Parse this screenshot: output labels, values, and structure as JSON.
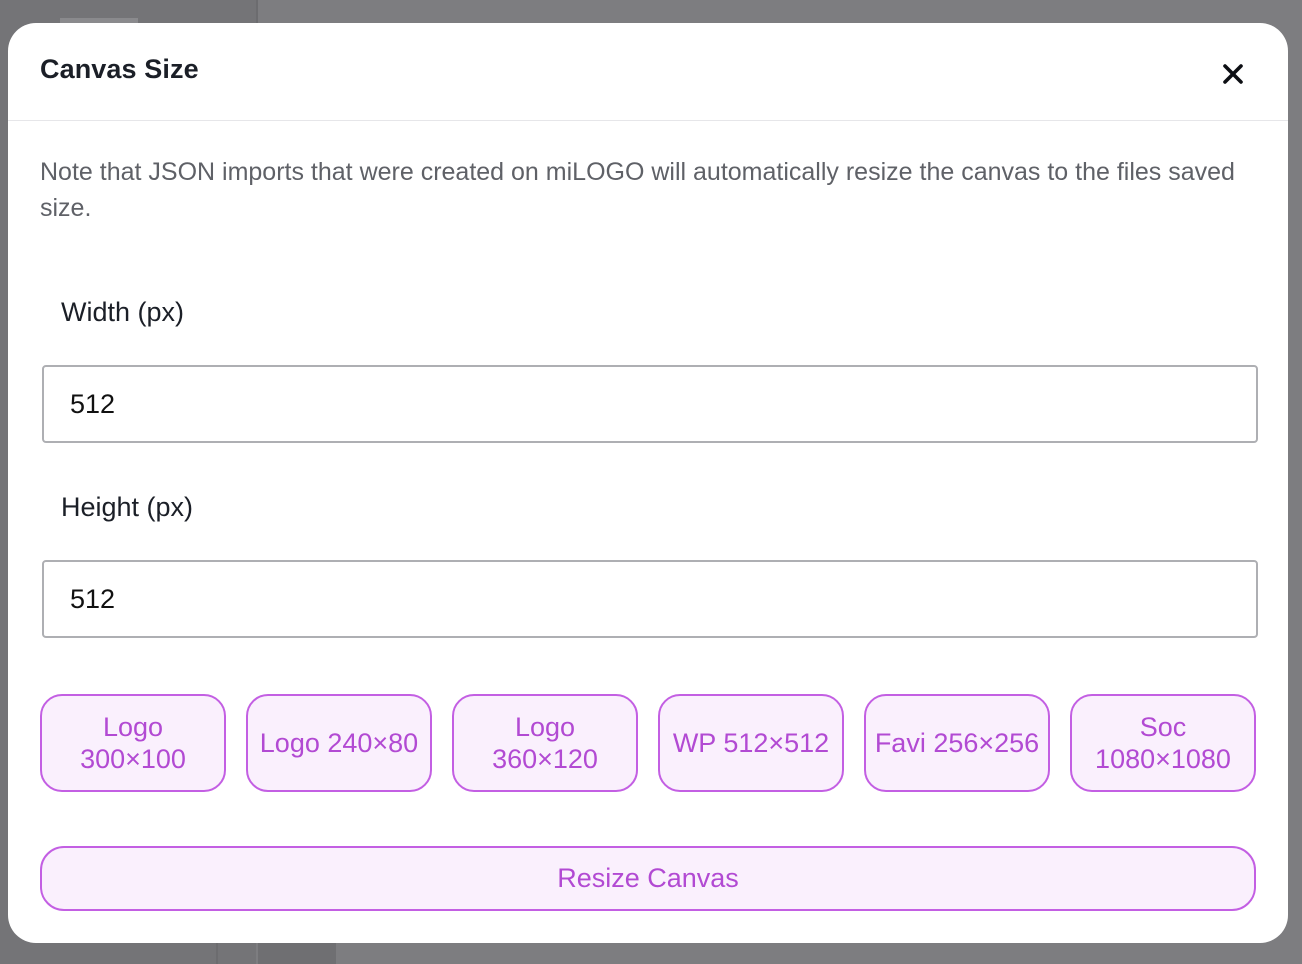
{
  "modal": {
    "title": "Canvas Size",
    "close_icon": "close-icon",
    "note": "Note that JSON imports that were created on miLOGO will automatically resize the canvas to the files saved size."
  },
  "width_field": {
    "label": "Width (px)",
    "value": "512"
  },
  "height_field": {
    "label": "Height (px)",
    "value": "512"
  },
  "presets": [
    {
      "label": "Logo 300×100"
    },
    {
      "label": "Logo 240×80"
    },
    {
      "label": "Logo 360×120"
    },
    {
      "label": "WP 512×512"
    },
    {
      "label": "Favi 256×256"
    },
    {
      "label": "Soc 1080×1080"
    }
  ],
  "actions": {
    "resize_label": "Resize Canvas"
  },
  "colors": {
    "accent": "#b24ad3",
    "accent_border": "#c35fe3",
    "accent_bg": "#faf0fd",
    "overlay": "#7d7d80"
  }
}
